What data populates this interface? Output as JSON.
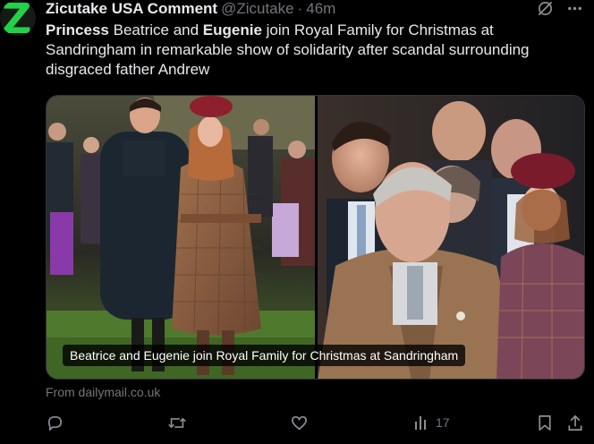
{
  "tweet": {
    "author_name": "Zicutake USA Comment",
    "handle": "@Zicutake",
    "separator": "·",
    "time": "46m",
    "text_bold_1": "Princess",
    "text_part_1": " Beatrice and ",
    "text_bold_2": "Eugenie",
    "text_part_2": " join Royal Family for Christmas at Sandringham in remarkable show of solidarity after scandal surrounding disgraced father Andrew",
    "media_caption": "Beatrice and Eugenie join Royal Family for Christmas at Sandringham",
    "source": "From dailymail.co.uk"
  },
  "actions": {
    "views_count": "17"
  },
  "colors": {
    "background": "#000000",
    "text": "#e7e9ea",
    "muted": "#71767b",
    "avatar_accent": "#22d04a"
  },
  "icons": [
    "grok-icon",
    "more-icon",
    "reply-icon",
    "retweet-icon",
    "like-icon",
    "views-icon",
    "bookmark-icon",
    "share-icon"
  ]
}
